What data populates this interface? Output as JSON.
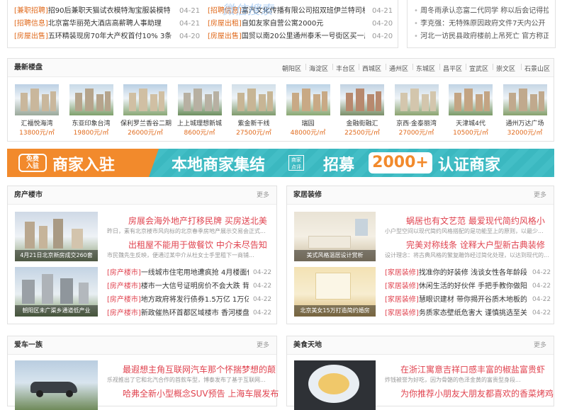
{
  "top_news": {
    "left": [
      {
        "tag": "[兼职招聘]",
        "text": "招90后兼职天猫试衣模特淘宝服装模特",
        "date": "04-21"
      },
      {
        "tag": "[招聘信息]",
        "text": "北京富华丽苑大酒店高薪聘人事助理",
        "date": "04-21"
      },
      {
        "tag": "[房屋出售]",
        "text": "五环精装现房70年大产权首付10% 3条地铁",
        "date": "04-20"
      }
    ],
    "middle": [
      {
        "tag": "[招聘信息]",
        "text": "富汽文化传播有限公司招双班伊兰特司机",
        "date": "04-21"
      },
      {
        "tag": "[房屋出租]",
        "text": "自如友家自营公寓2000元",
        "date": "04-20"
      },
      {
        "tag": "[房屋出售]",
        "text": "国贸以南20公里通州泰禾一号街区买一层送",
        "date": "04-20"
      }
    ],
    "right": [
      "周冬雨承认恋富二代同学 称以后会记得拉",
      "李克强：无特殊原因政府文件7天内公开",
      "河北一访民县政府楼前上吊死亡 官方称正"
    ],
    "watermark": "微信搜索"
  },
  "latest": {
    "title": "最新楼盘",
    "districts": [
      "朝阳区",
      "海淀区",
      "丰台区",
      "西城区",
      "通州区",
      "东城区",
      "昌平区",
      "宣武区",
      "崇文区",
      "石景山区"
    ],
    "properties": [
      {
        "name": "汇福悦海湾",
        "price": "13800元/㎡"
      },
      {
        "name": "东亚印象台湾",
        "price": "19800元/㎡"
      },
      {
        "name": "保利罗兰香谷二期",
        "price": "26000元/㎡"
      },
      {
        "name": "上上城理想新城",
        "price": "8600元/㎡"
      },
      {
        "name": "紫金新干线",
        "price": "27500元/㎡"
      },
      {
        "name": "瑞园",
        "price": "48000元/㎡"
      },
      {
        "name": "金融街融汇",
        "price": "22500元/㎡"
      },
      {
        "name": "京西·金泰丽湾",
        "price": "27000元/㎡"
      },
      {
        "name": "天津城4代",
        "price": "10500元/㎡"
      },
      {
        "name": "通州万达广场",
        "price": "32000元/㎡"
      }
    ]
  },
  "banner": {
    "badge_top": "免费",
    "badge_bottom": "入驻",
    "merchant": "商家入驻",
    "slogan": "本地商家集结",
    "seal_top": "商家",
    "seal_bottom": "点评",
    "recruit": "招募",
    "count": "2000+",
    "certified": "认证商家",
    "colors": {
      "orange": "#f28a2c",
      "teal": "#3bb8c0"
    }
  },
  "realestate": {
    "title": "房产楼市",
    "more": "更多",
    "headline": "房展会海外地产打移民牌 买房送北美",
    "summary": "昨日，素有北京楼市风向标的北京春季房地产展示交易会正式...",
    "headline2": "出租屋不能用于做餐饮 中介未尽告知",
    "summary2": "市民魏先生反映，便通过某中介从杜女士手里租下一商铺...",
    "img1_caption": "4月21日北京新房成交260套",
    "img2_caption": "朝阳区未广渠乡通道低产业",
    "rows": [
      {
        "tag": "[房产楼市]",
        "text": "一线城市住宅用地遭疯抢 4月楼面价溢",
        "date": "04-22"
      },
      {
        "tag": "[房产楼市]",
        "text": "楼市一大信号证明房价不会大跌 背后",
        "date": "04-22"
      },
      {
        "tag": "[房产楼市]",
        "text": "地方政府将发行债券1.5万亿 1万亿为",
        "date": "04-22"
      },
      {
        "tag": "[房产楼市]",
        "text": "新政催热环首都区域楼市 香河楼盘借",
        "date": "04-22"
      }
    ]
  },
  "home": {
    "title": "家居装修",
    "more": "更多",
    "headline": "蜗居也有文艺范 最爱现代简约风格小",
    "summary": "小户型空间以现代简约风格搭配的是功能至上的原则，以最少...",
    "headline2": "完美对称线条 诠释大户型新古典装修",
    "summary2": "设计理念：将古典风格的繁复雕饰经过简化处理，以达到现代的...",
    "img1_caption": "美式风格温居设计赏析",
    "img2_caption": "北京美女15万打造简约婚房",
    "rows": [
      {
        "tag": "[家居装修]",
        "text": "找准你的好装修 浅谈女性各年龄段的",
        "date": "04-22"
      },
      {
        "tag": "[家居装修]",
        "text": "休闲生活的好伙伴 手把手教你做阳台",
        "date": "04-22"
      },
      {
        "tag": "[家居装修]",
        "text": "慧眼识建材 带你揭开谷质木地板的猫",
        "date": "04-22"
      },
      {
        "tag": "[家居装修]",
        "text": "务质家态壁纸危害大 谨慎挑选至关重",
        "date": "04-22"
      }
    ]
  },
  "car": {
    "title": "爱车一族",
    "more": "更多",
    "headline": "最遐想主角互联网汽车那个怀揣梦想的颠",
    "summary": "乐视推出了它和北汽合作的首款车型，博泰发布了基于互联网...",
    "headline2": "哈弗全新小型概念SUV预告 上海车展发布"
  },
  "food": {
    "title": "美食天地",
    "more": "更多",
    "headline": "在浙江寓意吉祥口感丰富的椒盐富贵虾",
    "summary": "炸钱被誉为好吃，因为骨骼的色泽金黄的富贵型身段...",
    "headline2": "为你推荐小朋友大朋友都喜欢的香菜烤鸡"
  }
}
